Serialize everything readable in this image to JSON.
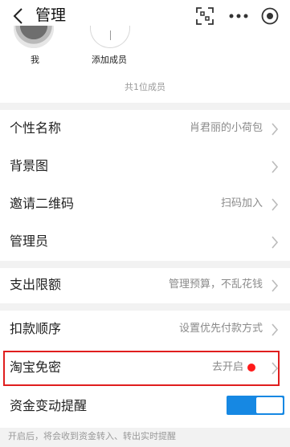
{
  "nav": {
    "title": "管理",
    "back_icon": "back-arrow-icon",
    "scan_icon": "scan-icon",
    "more_icon": "more-dots-icon",
    "close_icon": "close-circle-icon"
  },
  "members": {
    "me_label": "我",
    "add_label": "添加成员",
    "count_text": "共1位成员"
  },
  "settings": {
    "nickname": {
      "label": "个性名称",
      "value": "肖君丽的小荷包"
    },
    "background": {
      "label": "背景图",
      "value": ""
    },
    "invite_qr": {
      "label": "邀请二维码",
      "value": "扫码加入"
    },
    "admins": {
      "label": "管理员",
      "value": ""
    },
    "spend_limit": {
      "label": "支出限额",
      "value": "管理预算，不乱花钱"
    },
    "deduct_order": {
      "label": "扣款顺序",
      "value": "设置优先付款方式"
    },
    "taobao_nopwd": {
      "label": "淘宝免密",
      "value": "去开启",
      "highlight_color": "#e01e1e",
      "dot_color": "#ff1a1a"
    },
    "fund_alert": {
      "label": "资金变动提醒",
      "toggle_on": true,
      "toggle_color": "#1688e3"
    }
  },
  "footer_note": "开启后，将会收到资金转入、转出实时提醒"
}
